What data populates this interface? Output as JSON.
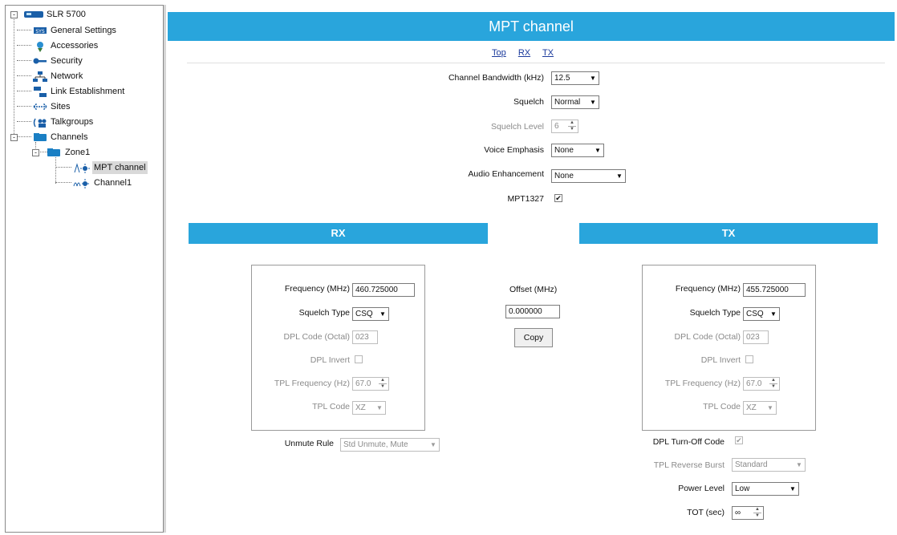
{
  "tree": {
    "root": {
      "label": "SLR 5700",
      "icon": "radio-device-icon",
      "expander": "-"
    },
    "items": [
      {
        "label": "General Settings",
        "icon": "general-settings-icon"
      },
      {
        "label": "Accessories",
        "icon": "accessories-icon"
      },
      {
        "label": "Security",
        "icon": "key-icon"
      },
      {
        "label": "Network",
        "icon": "network-icon"
      },
      {
        "label": "Link Establishment",
        "icon": "link-establishment-icon"
      },
      {
        "label": "Sites",
        "icon": "sites-icon"
      },
      {
        "label": "Talkgroups",
        "icon": "talkgroups-icon"
      }
    ],
    "channels": {
      "label": "Channels",
      "icon": "folder-icon",
      "expander": "-"
    },
    "zone": {
      "label": "Zone1",
      "icon": "folder-icon",
      "expander": "-"
    },
    "zone_items": [
      {
        "label": "MPT channel",
        "icon": "channel-icon",
        "selected": true
      },
      {
        "label": "Channel1",
        "icon": "channel-icon",
        "selected": false
      }
    ]
  },
  "header": {
    "title": "MPT channel"
  },
  "links": {
    "top": "Top",
    "rx": "RX",
    "tx": "TX"
  },
  "general": {
    "bandwidth_label": "Channel Bandwidth (kHz)",
    "bandwidth_value": "12.5",
    "squelch_label": "Squelch",
    "squelch_value": "Normal",
    "squelch_level_label": "Squelch Level",
    "squelch_level_value": "6",
    "voice_emphasis_label": "Voice Emphasis",
    "voice_emphasis_value": "None",
    "audio_enh_label": "Audio Enhancement",
    "audio_enh_value": "None",
    "mpt1327_label": "MPT1327",
    "mpt1327_checked": "✔"
  },
  "rx": {
    "title": "RX",
    "freq_label": "Frequency (MHz)",
    "freq_value": "460.725000",
    "squelch_type_label": "Squelch Type",
    "squelch_type_value": "CSQ",
    "dpl_code_label": "DPL Code (Octal)",
    "dpl_code_value": "023",
    "dpl_invert_label": "DPL Invert",
    "tpl_freq_label": "TPL Frequency (Hz)",
    "tpl_freq_value": "67.0",
    "tpl_code_label": "TPL Code",
    "tpl_code_value": "XZ",
    "unmute_label": "Unmute Rule",
    "unmute_value": "Std Unmute, Mute"
  },
  "offset": {
    "label": "Offset (MHz)",
    "value": "0.000000",
    "copy_label": "Copy"
  },
  "tx": {
    "title": "TX",
    "freq_label": "Frequency (MHz)",
    "freq_value": "455.725000",
    "squelch_type_label": "Squelch Type",
    "squelch_type_value": "CSQ",
    "dpl_code_label": "DPL Code (Octal)",
    "dpl_code_value": "023",
    "dpl_invert_label": "DPL Invert",
    "tpl_freq_label": "TPL Frequency (Hz)",
    "tpl_freq_value": "67.0",
    "tpl_code_label": "TPL Code",
    "tpl_code_value": "XZ",
    "dpl_turnoff_label": "DPL Turn-Off Code",
    "dpl_turnoff_checked": "✔",
    "tpl_reverse_label": "TPL Reverse Burst",
    "tpl_reverse_value": "Standard",
    "power_label": "Power Level",
    "power_value": "Low",
    "tot_label": "TOT (sec)",
    "tot_value": "∞"
  },
  "colors": {
    "accent": "#29a5dc",
    "link": "#1b3a9c"
  }
}
